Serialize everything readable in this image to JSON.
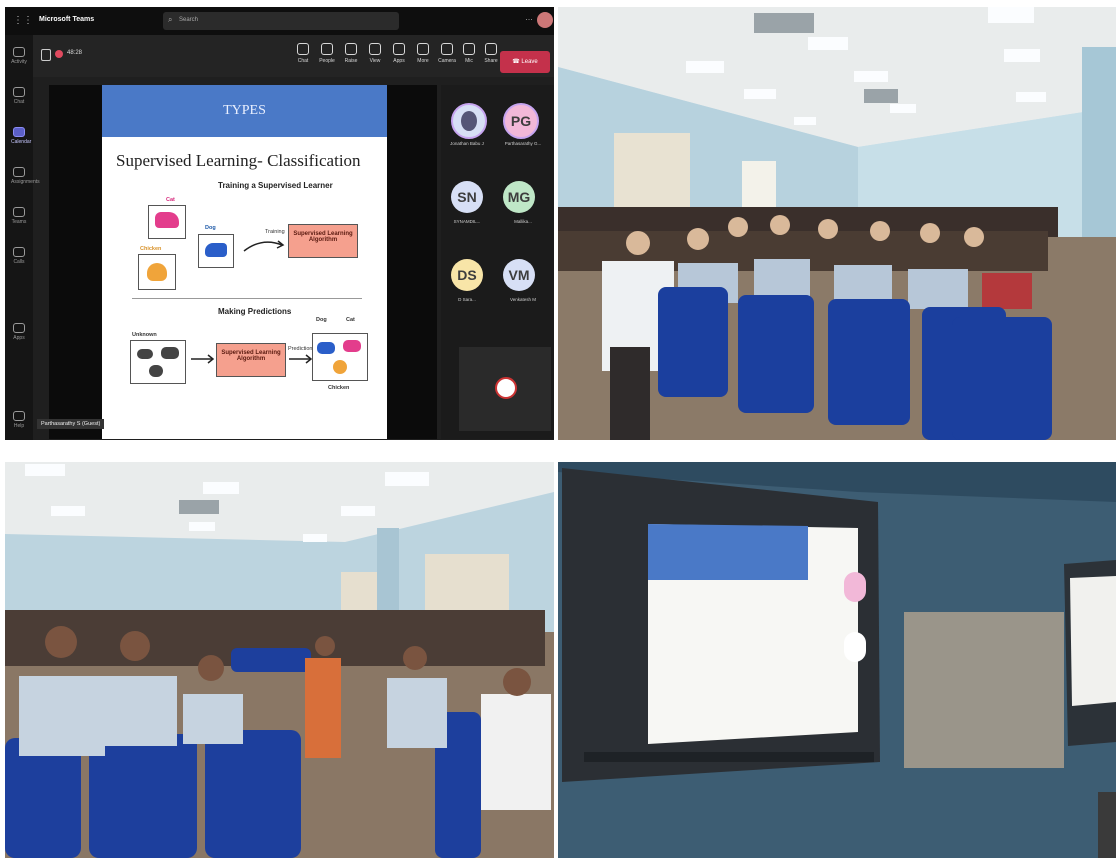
{
  "teams": {
    "app_title": "Microsoft Teams",
    "search_placeholder": "Search",
    "call_timer": "48:28",
    "toolbar": [
      {
        "label": "Chat",
        "icon": "chat-icon"
      },
      {
        "label": "People",
        "icon": "people-icon"
      },
      {
        "label": "Raise",
        "icon": "raise-hand-icon"
      },
      {
        "label": "View",
        "icon": "view-icon"
      },
      {
        "label": "Apps",
        "icon": "apps-icon"
      },
      {
        "label": "More",
        "icon": "more-icon"
      },
      {
        "label": "Camera",
        "icon": "camera-icon"
      },
      {
        "label": "Mic",
        "icon": "mic-icon"
      },
      {
        "label": "Share",
        "icon": "share-icon"
      }
    ],
    "leave_label": "Leave",
    "rail": [
      {
        "label": "Activity",
        "icon": "bell-icon"
      },
      {
        "label": "Chat",
        "icon": "chat-icon"
      },
      {
        "label": "Calendar",
        "icon": "calendar-icon"
      },
      {
        "label": "Assignments",
        "icon": "assignments-icon"
      },
      {
        "label": "Teams",
        "icon": "teams-icon"
      },
      {
        "label": "Calls",
        "icon": "calls-icon"
      },
      {
        "label": "Apps",
        "icon": "apps-icon"
      },
      {
        "label": "Help",
        "icon": "help-icon"
      }
    ],
    "presenter_name": "Parthasarathy S (Guest)",
    "slide": {
      "header": "TYPES",
      "title": "Supervised Learning- Classification",
      "training_heading": "Training a Supervised Learner",
      "labels": {
        "cat": "Cat",
        "dog": "Dog",
        "chicken": "Chicken",
        "training": "Training",
        "unknown": "Unknown",
        "prediction": "Prediction"
      },
      "algo_label": "Supervised Learning Algorithm",
      "predicting_heading": "Making Predictions"
    },
    "participants": [
      {
        "initials": "",
        "name": "Jonathan Babu J",
        "color": "#d7dff5"
      },
      {
        "initials": "PG",
        "name": "Parthasarathy G...",
        "color": "#f2b8d8"
      },
      {
        "initials": "SN",
        "name": "SYNAMDIL...",
        "color": "#d7dff5"
      },
      {
        "initials": "MG",
        "name": "Mallika...",
        "color": "#bfe7c7"
      },
      {
        "initials": "DS",
        "name": "D Sara...",
        "color": "#f8e5a8"
      },
      {
        "initials": "VM",
        "name": "Venkatesh M",
        "color": "#d7dff5"
      }
    ]
  }
}
